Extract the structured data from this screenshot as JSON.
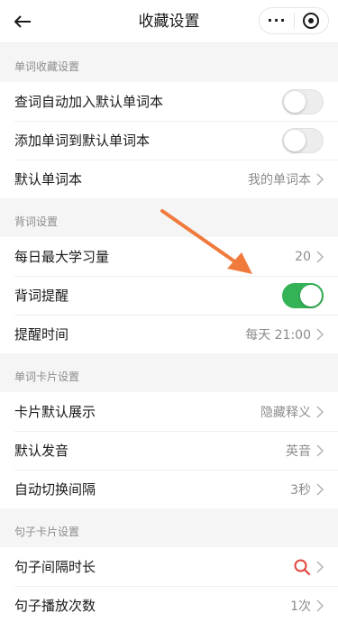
{
  "nav": {
    "title": "收藏设置",
    "more_label": "···"
  },
  "colors": {
    "accent_green": "#34b356",
    "annotation_orange": "#f07a3c",
    "search_red": "#e0463e"
  },
  "sections": [
    {
      "header": "单词收藏设置",
      "rows": [
        {
          "label": "查词自动加入默认单词本",
          "toggle": false
        },
        {
          "label": "添加单词到默认单词本",
          "toggle": false
        },
        {
          "label": "默认单词本",
          "value": "我的单词本"
        }
      ]
    },
    {
      "header": "背词设置",
      "rows": [
        {
          "label": "每日最大学习量",
          "value": "20"
        },
        {
          "label": "背词提醒",
          "toggle": true
        },
        {
          "label": "提醒时间",
          "value": "每天 21:00"
        }
      ]
    },
    {
      "header": "单词卡片设置",
      "rows": [
        {
          "label": "卡片默认展示",
          "value": "隐藏释义"
        },
        {
          "label": "默认发音",
          "value": "英音"
        },
        {
          "label": "自动切换间隔",
          "value": "3秒"
        }
      ]
    },
    {
      "header": "句子卡片设置",
      "rows": [
        {
          "label": "句子间隔时长",
          "icon": "search-icon"
        },
        {
          "label": "句子播放次数",
          "value": "1次"
        }
      ]
    }
  ]
}
